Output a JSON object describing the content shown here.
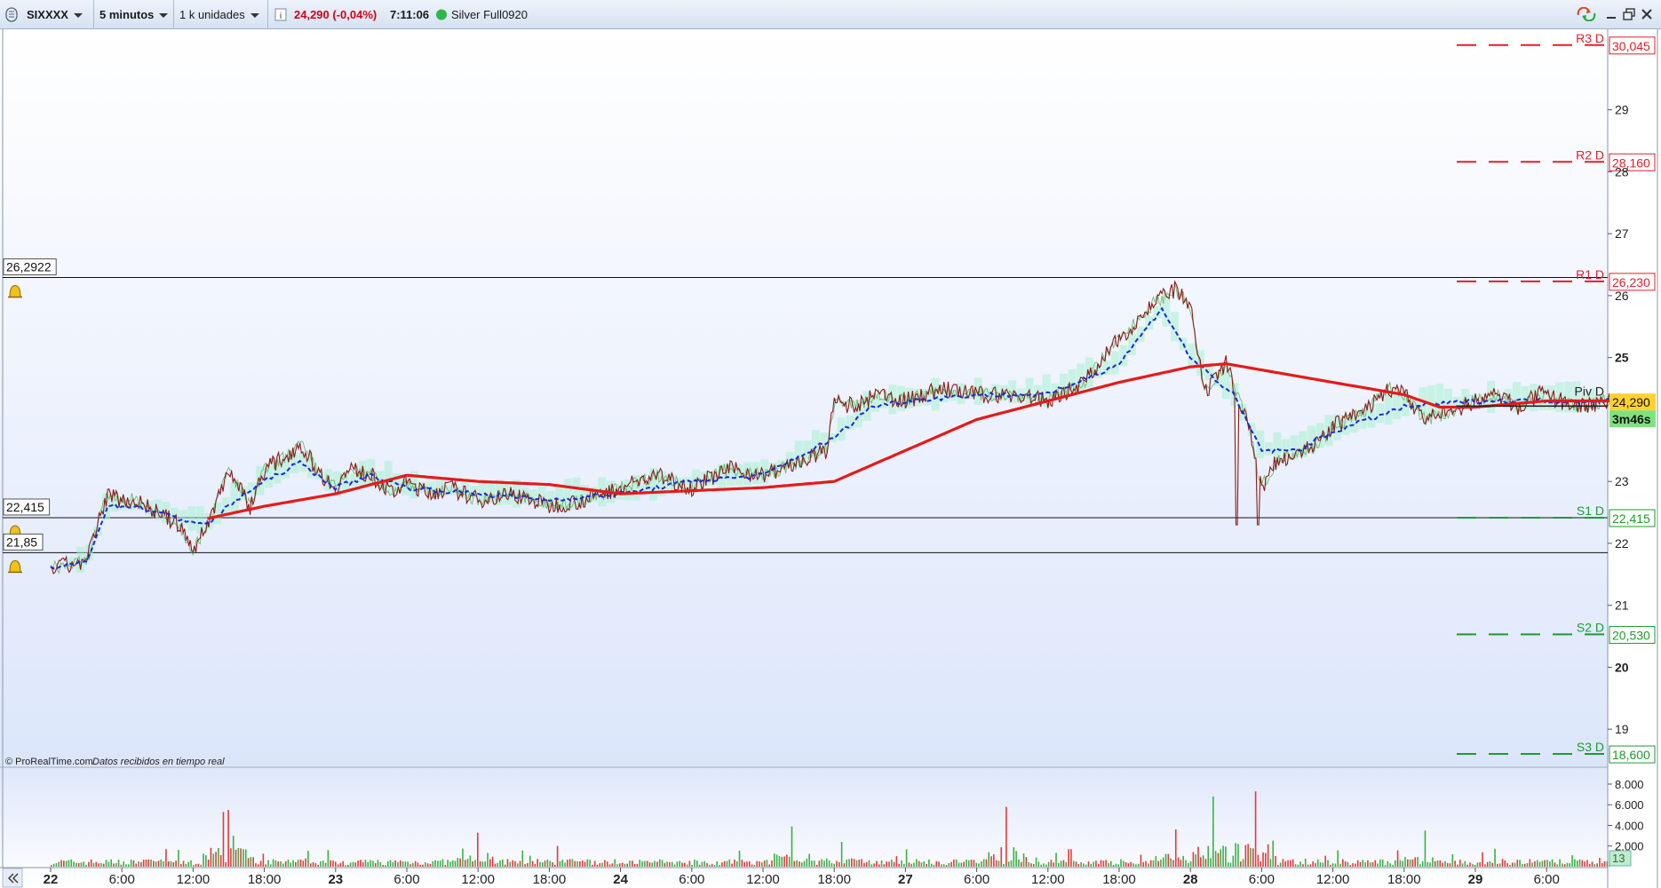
{
  "toolbar": {
    "symbol": "SIXXXX",
    "timeframe": "5 minutos",
    "units": "1 k unidades",
    "info_icon": "info-icon",
    "price_change": "24,290 (-0,04%)",
    "time": "7:11:06",
    "account": "Silver Full0920",
    "status_color": "#2db84a",
    "change_color": "#d0021b"
  },
  "footer": {
    "copyright": "© ProRealTime.com",
    "note": "Datos recibidos en tiempo real",
    "collapse_icon": "double-chevron-left-icon"
  },
  "chart_data": [
    {
      "type": "line",
      "panel": "price",
      "y_ticks": [
        {
          "v": 19,
          "label": "19"
        },
        {
          "v": 20,
          "label": "20",
          "bold": true
        },
        {
          "v": 21,
          "label": "21"
        },
        {
          "v": 22,
          "label": "22"
        },
        {
          "v": 23,
          "label": "23"
        },
        {
          "v": 25,
          "label": "25",
          "bold": true
        },
        {
          "v": 26,
          "label": "26"
        },
        {
          "v": 27,
          "label": "27"
        },
        {
          "v": 28,
          "label": "28"
        },
        {
          "v": 29,
          "label": "29"
        }
      ],
      "ylim": [
        18.4,
        30.3
      ],
      "x_ticks": [
        {
          "label": "22",
          "bold": true
        },
        {
          "label": "6:00"
        },
        {
          "label": "12:00"
        },
        {
          "label": "18:00"
        },
        {
          "label": "23",
          "bold": true
        },
        {
          "label": "6:00"
        },
        {
          "label": "12:00"
        },
        {
          "label": "18:00"
        },
        {
          "label": "24",
          "bold": true
        },
        {
          "label": "6:00"
        },
        {
          "label": "12:00"
        },
        {
          "label": "18:00"
        },
        {
          "label": "27",
          "bold": true
        },
        {
          "label": "6:00"
        },
        {
          "label": "12:00"
        },
        {
          "label": "18:00"
        },
        {
          "label": "28",
          "bold": true
        },
        {
          "label": "6:00"
        },
        {
          "label": "12:00"
        },
        {
          "label": "18:00"
        },
        {
          "label": "29",
          "bold": true
        },
        {
          "label": "6:00"
        }
      ],
      "pivots": [
        {
          "name": "R3 D",
          "value": 30.045,
          "label": "30,045",
          "color": "#e0202a"
        },
        {
          "name": "R2 D",
          "value": 28.16,
          "label": "28,160",
          "color": "#e0202a"
        },
        {
          "name": "R1 D",
          "value": 26.23,
          "label": "26,230",
          "color": "#e0202a"
        },
        {
          "name": "Piv D",
          "value": 24.345,
          "label": "24,345",
          "color": "#222222"
        },
        {
          "name": "S1 D",
          "value": 22.415,
          "label": "22,415",
          "color": "#1e9b2e"
        },
        {
          "name": "S2 D",
          "value": 20.53,
          "label": "20,530",
          "color": "#1e9b2e"
        },
        {
          "name": "S3 D",
          "value": 18.6,
          "label": "18,600",
          "color": "#1e9b2e"
        }
      ],
      "horizontal_lines": [
        {
          "value": 26.2922,
          "label": "26,2922",
          "alert": true
        },
        {
          "value": 22.415,
          "label": "22,415",
          "alert": true
        },
        {
          "value": 21.85,
          "label": "21,85",
          "alert": true
        }
      ],
      "current_price": {
        "value": 24.29,
        "label": "24,290",
        "bg": "#ffd22e"
      },
      "countdown": {
        "label": "3m46s",
        "bg": "#7ee37e"
      },
      "series": [
        {
          "style": "price",
          "color": "#8b1a1a",
          "x": [
            0,
            0.5,
            0.8,
            1.0,
            1.2,
            1.5,
            1.8,
            2.0,
            2.1,
            2.2,
            2.5,
            2.8,
            3.0,
            3.3,
            3.5,
            3.8,
            4.0,
            4.2,
            4.5,
            4.8,
            5.0,
            5.3,
            5.6,
            6.0,
            6.5,
            7.0,
            7.5,
            8.0,
            8.5,
            9.0,
            9.5,
            10.0,
            10.5,
            10.9,
            11.0,
            11.3,
            11.6,
            12.0,
            12.5,
            13.0,
            13.5,
            14.0,
            14.5,
            15.0,
            15.5,
            15.8,
            16.0,
            16.2,
            16.5,
            16.8,
            17.0,
            17.2,
            17.5,
            17.8,
            18.0,
            18.4,
            18.8,
            19.0,
            19.3,
            19.6,
            20.0,
            20.3,
            20.6,
            20.9,
            21.2,
            21.5,
            21.8,
            22.1
          ],
          "y": [
            21.6,
            21.7,
            22.8,
            22.7,
            22.7,
            22.5,
            22.3,
            21.9,
            22.1,
            22.3,
            23.2,
            22.6,
            23.2,
            23.4,
            23.6,
            23.1,
            22.9,
            23.2,
            23.1,
            22.8,
            23.0,
            22.8,
            22.9,
            22.7,
            22.8,
            22.6,
            22.7,
            22.9,
            23.1,
            22.9,
            23.2,
            23.1,
            23.3,
            23.5,
            24.3,
            24.2,
            24.4,
            24.3,
            24.5,
            24.4,
            24.4,
            24.3,
            24.6,
            25.3,
            25.9,
            26.1,
            25.8,
            24.4,
            24.9,
            24.0,
            22.9,
            23.3,
            23.5,
            23.6,
            23.9,
            24.1,
            24.5,
            24.4,
            24.0,
            24.1,
            24.3,
            24.4,
            24.2,
            24.4,
            24.3,
            24.2,
            24.3,
            24.29
          ]
        },
        {
          "style": "dashed",
          "color": "#1a2ad6",
          "x": [
            0,
            0.5,
            0.8,
            1.2,
            1.8,
            2.2,
            2.6,
            3.0,
            3.5,
            4.0,
            4.5,
            5.0,
            6.0,
            7.0,
            8.0,
            9.0,
            10.0,
            11.0,
            11.5,
            12.0,
            13.0,
            14.0,
            15.0,
            15.6,
            16.0,
            16.3,
            16.6,
            17.0,
            17.5,
            18.0,
            19.0,
            20.0,
            21.0,
            22.0
          ],
          "y": [
            21.6,
            21.7,
            22.6,
            22.6,
            22.4,
            22.3,
            22.7,
            23.0,
            23.3,
            22.9,
            23.1,
            22.9,
            22.8,
            22.7,
            22.8,
            23.0,
            23.1,
            23.7,
            24.2,
            24.3,
            24.4,
            24.4,
            24.9,
            25.8,
            25.0,
            24.7,
            24.4,
            23.5,
            23.5,
            23.8,
            24.2,
            24.3,
            24.3,
            24.3
          ]
        },
        {
          "style": "thick",
          "color": "#e61a1a",
          "x": [
            2.2,
            3.0,
            4.0,
            5.0,
            6.0,
            7.0,
            8.0,
            9.0,
            10.0,
            11.0,
            12.0,
            13.0,
            14.0,
            15.0,
            16.0,
            16.5,
            17.0,
            17.5,
            18.0,
            19.0,
            19.5,
            20.0,
            20.5,
            21.0,
            21.5,
            22.0
          ],
          "y": [
            22.4,
            22.6,
            22.8,
            23.1,
            23.0,
            22.95,
            22.8,
            22.85,
            22.9,
            23.0,
            23.5,
            24.0,
            24.3,
            24.6,
            24.85,
            24.9,
            24.8,
            24.7,
            24.6,
            24.4,
            24.2,
            24.2,
            24.25,
            24.3,
            24.3,
            24.3
          ]
        }
      ]
    },
    {
      "type": "bar",
      "panel": "volume",
      "y_ticks": [
        {
          "v": 2000,
          "label": "2.000"
        },
        {
          "v": 4000,
          "label": "4.000"
        },
        {
          "v": 6000,
          "label": "6.000"
        },
        {
          "v": 8000,
          "label": "8.000"
        }
      ],
      "ylim": [
        0,
        8600
      ],
      "current_volume": {
        "label": "13"
      },
      "up_color": "#3cb043",
      "down_color": "#e23b3b",
      "spikes": [
        {
          "x": 1.6,
          "v": 1700
        },
        {
          "x": 2.4,
          "v": 5300
        },
        {
          "x": 2.5,
          "v": 5500
        },
        {
          "x": 2.55,
          "v": 3000
        },
        {
          "x": 6.0,
          "v": 3300
        },
        {
          "x": 7.1,
          "v": 2000
        },
        {
          "x": 10.4,
          "v": 3900
        },
        {
          "x": 11.1,
          "v": 2400
        },
        {
          "x": 13.4,
          "v": 5800
        },
        {
          "x": 14.3,
          "v": 1700
        },
        {
          "x": 15.8,
          "v": 3600
        },
        {
          "x": 16.3,
          "v": 6800
        },
        {
          "x": 16.9,
          "v": 7300
        },
        {
          "x": 19.3,
          "v": 3500
        },
        {
          "x": 20.1,
          "v": 1400
        }
      ]
    }
  ]
}
